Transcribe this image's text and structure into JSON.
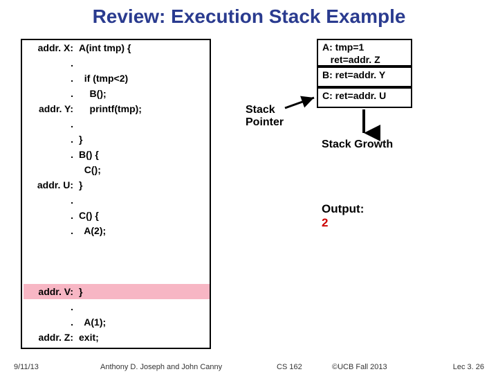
{
  "title": "Review: Execution Stack Example",
  "labels": {
    "r0": "addr. X:",
    "r3": "addr. Y:",
    "r7": "addr. U:",
    "r10": "addr. V:",
    "r12": "addr. Z:"
  },
  "code": {
    "r0": "A(int tmp) {",
    "r1": "  if (tmp<2)",
    "r2": "    B();",
    "r3": "    printf(tmp);",
    "r4": "}",
    "r5": "B() {",
    "r6": "  C();",
    "r7": "}",
    "r8": "C() {",
    "r9": "  A(2);",
    "r10": "}",
    "r11": "  A(1);",
    "r12": "exit;"
  },
  "stack": {
    "frameA": "A: tmp=1\n   ret=addr. Z",
    "frameB": "B: ret=addr. Y",
    "frameC": "C: ret=addr. U"
  },
  "stackPointer": "Stack\nPointer",
  "stackGrowth": "Stack Growth",
  "outputLabel": "Output:",
  "outputValue": "2",
  "footer": {
    "date": "9/11/13",
    "author": "Anthony D. Joseph and John Canny",
    "course": "CS 162",
    "copy": "©UCB Fall 2013",
    "lec": "Lec 3. 26"
  }
}
